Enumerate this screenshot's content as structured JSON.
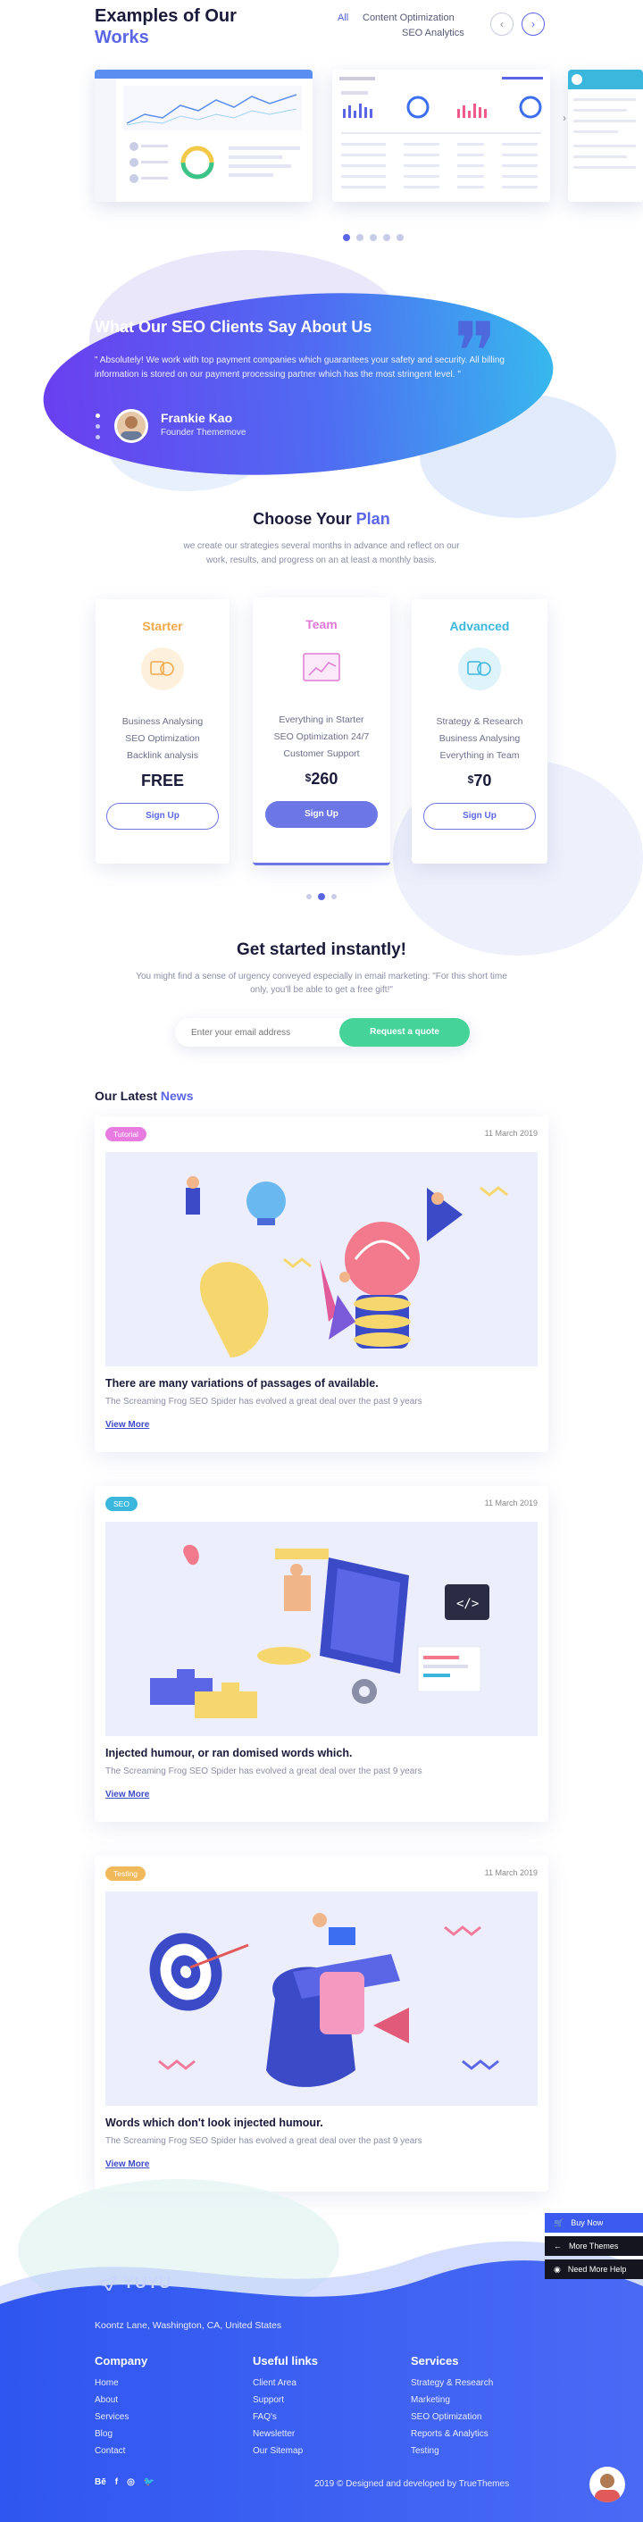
{
  "works": {
    "title": "Examples of Our",
    "title_accent": "Works",
    "filters": [
      "All",
      "Content Optimization",
      "SEO Analytics"
    ],
    "prev_label": "‹",
    "next_label": "›"
  },
  "testimonial": {
    "title": "What Our SEO Clients Say About Us",
    "quote": "\" Absolutely! We work with top payment companies which guarantees your safety and security. All billing information is stored on our payment processing partner which has the most stringent level. \"",
    "name": "Frankie Kao",
    "role": "Founder Thememove"
  },
  "plans": {
    "title": "Choose Your",
    "title_accent": "Plan",
    "subtitle": "we create our strategies several months in advance and reflect on our work, results, and progress on an at least a monthly basis.",
    "cards": [
      {
        "name": "Starter",
        "color": "#f2a94a",
        "features": [
          "Business Analysing",
          "SEO Optimization",
          "Backlink analysis"
        ],
        "price": "FREE",
        "button": "Sign Up"
      },
      {
        "name": "Team",
        "color": "#e07ad6",
        "features": [
          "Everything in Starter",
          "SEO Optimization 24/7",
          "Customer Support"
        ],
        "price_symbol": "$",
        "price": "260",
        "button": "Sign Up"
      },
      {
        "name": "Advanced",
        "color": "#3bb7dd",
        "features": [
          "Strategy & Research",
          "Business Analysing",
          "Everything in Team"
        ],
        "price_symbol": "$",
        "price": "70",
        "button": "Sign Up"
      }
    ]
  },
  "cta": {
    "title": "Get started instantly!",
    "text": "You might find a sense of urgency conveyed especially in email marketing: \"For this short time only, you'll be able to get a free gift!\"",
    "email_placeholder": "Enter your email address",
    "button": "Request a quote"
  },
  "news": {
    "title": "Our Latest",
    "title_accent": "News",
    "items": [
      {
        "tag": "Tutorial",
        "tag_color": "#e87be0",
        "date": "11 March 2019",
        "title": "There are many variations of passages of available.",
        "text": "The Screaming Frog SEO Spider has evolved a great deal over the past 9 years",
        "more": "View More"
      },
      {
        "tag": "SEO",
        "tag_color": "#3bb7dd",
        "date": "11 March 2019",
        "title": "Injected humour, or ran domised words which.",
        "text": "The Screaming Frog SEO Spider has evolved a great deal over the past 9 years",
        "more": "View More"
      },
      {
        "tag": "Testing",
        "tag_color": "#f2b95a",
        "date": "11 March 2019",
        "title": "Words which don't look injected humour.",
        "text": "The Screaming Frog SEO Spider has evolved a great deal over the past 9 years",
        "more": "View More"
      }
    ]
  },
  "side_buttons": [
    "Buy Now",
    "More Themes",
    "Need More Help"
  ],
  "footer": {
    "logo": "YUYU",
    "address": "Koontz Lane, Washington, CA, United States",
    "columns": [
      {
        "title": "Company",
        "links": [
          "Home",
          "About",
          "Services",
          "Blog",
          "Contact"
        ]
      },
      {
        "title": "Useful links",
        "links": [
          "Client Area",
          "Support",
          "FAQ's",
          "Newsletter",
          "Our Sitemap"
        ]
      },
      {
        "title": "Services",
        "links": [
          "Strategy & Research",
          "Marketing",
          "SEO Optimization",
          "Reports & Analytics",
          "Testing"
        ]
      }
    ],
    "social": [
      "Bē",
      "f",
      "◎",
      "🐦"
    ],
    "copyright": "2019 © Designed and developed by TrueThemes"
  },
  "colors": {
    "accent": "#5a66e6",
    "green": "#46d39a",
    "footer_blue": "#3b5bf0"
  }
}
